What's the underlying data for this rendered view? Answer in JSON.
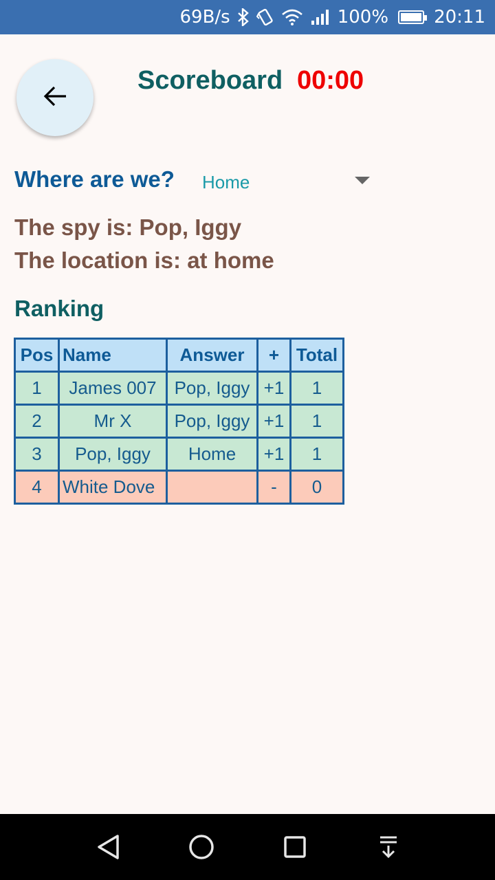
{
  "status_bar": {
    "speed": "69B/s",
    "battery": "100%",
    "time": "20:11",
    "icons": [
      "bluetooth-icon",
      "vibrate-icon",
      "wifi-icon",
      "signal-icon",
      "battery-icon"
    ]
  },
  "header": {
    "back_icon": "arrow-left-icon",
    "title": "Scoreboard",
    "timer": "00:00"
  },
  "location_select": {
    "label": "Where are we?",
    "selected": "Home"
  },
  "result": {
    "spy_line": "The spy is: Pop, Iggy",
    "location_line": "The location is: at home"
  },
  "ranking": {
    "title": "Ranking",
    "columns": [
      "Pos",
      "Name",
      "Answer",
      "+",
      "Total"
    ],
    "rows": [
      {
        "pos": "1",
        "name": "James 007",
        "answer": "Pop, Iggy",
        "plus": "+1",
        "total": "1"
      },
      {
        "pos": "2",
        "name": "Mr X",
        "answer": "Pop, Iggy",
        "plus": "+1",
        "total": "1"
      },
      {
        "pos": "3",
        "name": "Pop, Iggy",
        "answer": "Home",
        "plus": "+1",
        "total": "1"
      },
      {
        "pos": "4",
        "name": "White Dove",
        "answer": "",
        "plus": "-",
        "total": "0"
      }
    ]
  },
  "colors": {
    "title": "#0f5f62",
    "timer": "#ee0000",
    "label_blue": "#0e5a96",
    "info_brown": "#7a5548",
    "row_correct": "#c8e8d3",
    "row_wrong": "#fccbba",
    "header_row": "#bfe0f7"
  },
  "nav_bar": {
    "icons": [
      "back-triangle-icon",
      "home-circle-icon",
      "recents-square-icon",
      "notifications-pulldown-icon"
    ]
  }
}
